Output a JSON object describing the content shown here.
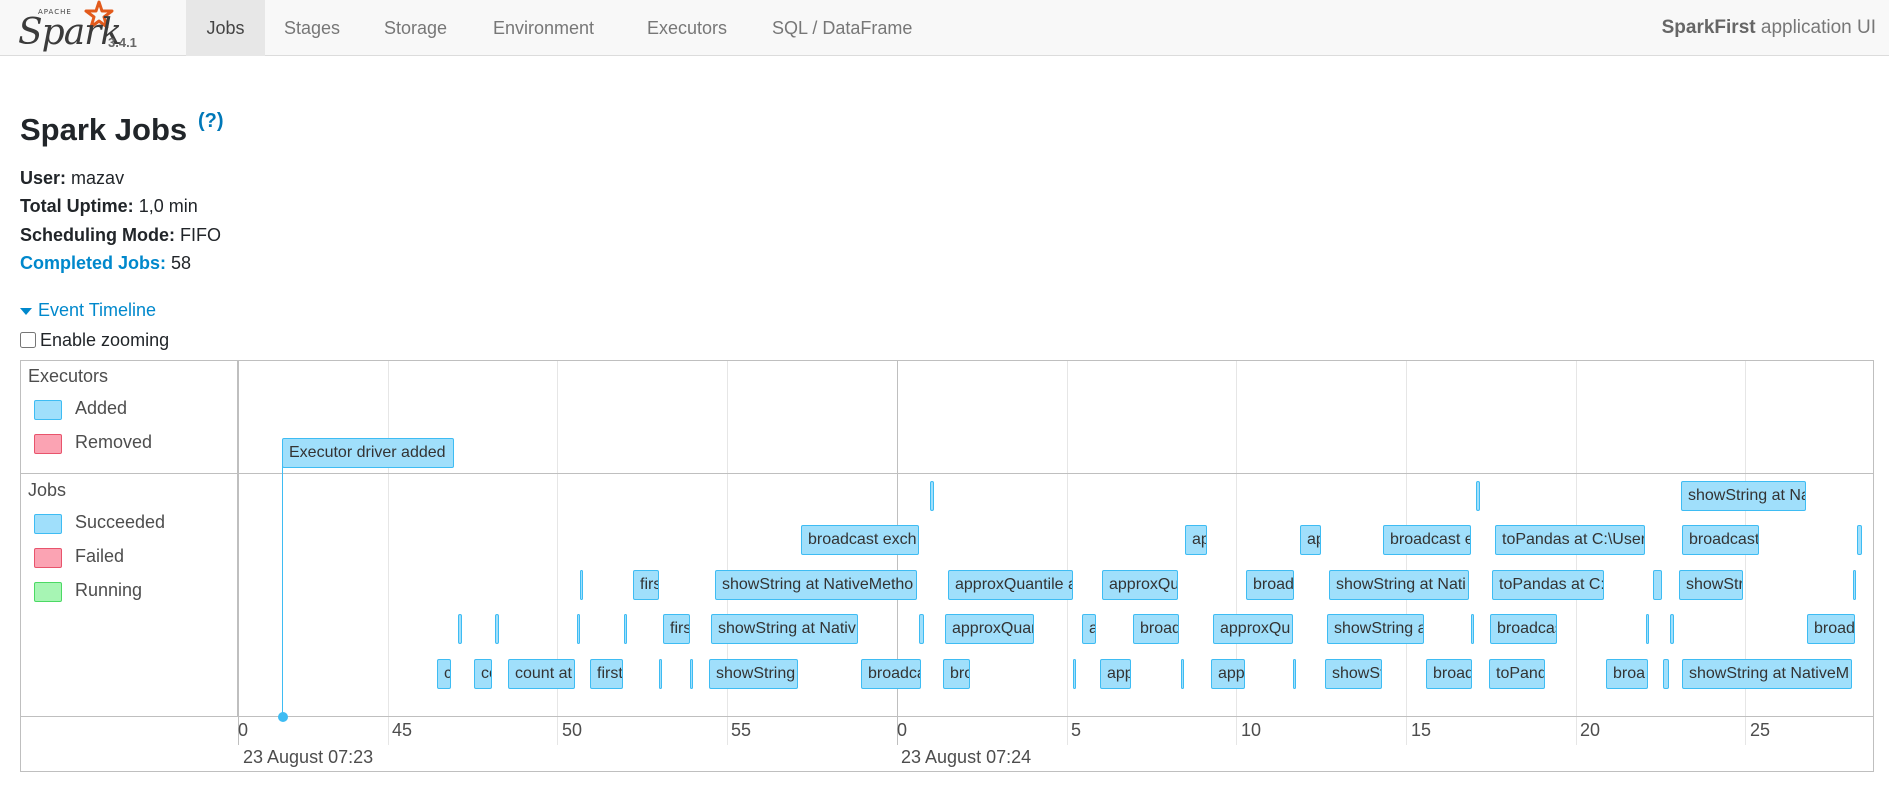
{
  "navbar": {
    "logo_apache": "APACHE",
    "logo_text": "Spark",
    "version": "3.4.1",
    "tabs": [
      "Jobs",
      "Stages",
      "Storage",
      "Environment",
      "Executors",
      "SQL / DataFrame"
    ],
    "active_tab": "Jobs",
    "app_name": "SparkFirst",
    "app_suffix": " application UI"
  },
  "page": {
    "title": "Spark Jobs",
    "help": "(?)",
    "user_label": "User:",
    "user": "mazav",
    "uptime_label": "Total Uptime:",
    "uptime": "1,0 min",
    "mode_label": "Scheduling Mode:",
    "mode": "FIFO",
    "completed_label": "Completed Jobs:",
    "completed": "58",
    "timeline_toggle": "Event Timeline",
    "zoom_label": "Enable zooming"
  },
  "timeline": {
    "executors_title": "Executors",
    "executors_legend": [
      {
        "label": "Added",
        "color": "#a0dffb",
        "border": "#3ebcf3"
      },
      {
        "label": "Removed",
        "color": "#fba3b3",
        "border": "#e8546c"
      }
    ],
    "executor_event": "Executor driver added",
    "jobs_title": "Jobs",
    "jobs_legend": [
      {
        "label": "Succeeded",
        "color": "#a0dffb",
        "border": "#3ebcf3"
      },
      {
        "label": "Failed",
        "color": "#fba3b3",
        "border": "#e8546c"
      },
      {
        "label": "Running",
        "color": "#a7f5b4",
        "border": "#4cd964"
      }
    ],
    "ticks": [
      "0",
      "45",
      "50",
      "55",
      "0",
      "5",
      "10",
      "15",
      "20",
      "25"
    ],
    "major_labels": [
      "23 August 07:23",
      "23 August 07:24"
    ],
    "jobs": [
      "showString at Na",
      "broadcast exch",
      "ap",
      "ap",
      "broadcast e",
      "toPandas at C:\\Users",
      "broadcast",
      "firs",
      "showString at NativeMetho",
      "approxQuantile a",
      "approxQu",
      "broad",
      "showString at Nati",
      "toPandas at C:\\",
      "showStr",
      "firs",
      "showString at Nativ",
      "approxQuar",
      "a",
      "broad",
      "approxQu",
      "showString a",
      "broadcas",
      "broad",
      "c",
      "co",
      "count at",
      "first",
      "showString",
      "broadca",
      "bro",
      "app",
      "app",
      "showSt",
      "broad",
      "toPand",
      "broa",
      "showString at NativeM"
    ]
  }
}
